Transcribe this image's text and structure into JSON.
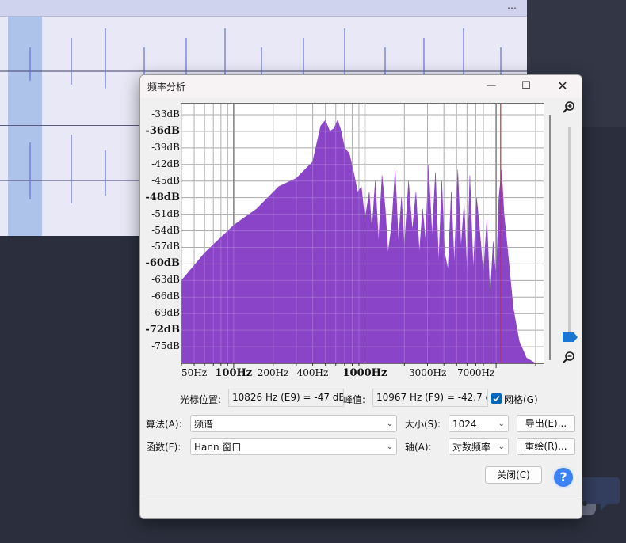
{
  "background": {
    "menu_dots": "⋯"
  },
  "dialog": {
    "title": "频率分析",
    "minimize_glyph": "—",
    "maximize_glyph": "☐",
    "close_glyph": "✕",
    "cursor_label": "光标位置:",
    "cursor_value": "10826 Hz (E9) = -47 dB",
    "peak_label": "峰值:",
    "peak_value": "10967 Hz (F9) = -42.7 d",
    "grid_label": "网格(G)",
    "grid_checked": true,
    "algorithm_label": "算法(A):",
    "algorithm_value": "频谱",
    "size_label": "大小(S):",
    "size_value": "1024",
    "export_button": "导出(E)...",
    "function_label": "函数(F):",
    "function_value": "Hann 窗口",
    "axis_label": "轴(A):",
    "axis_value": "对数频率",
    "replot_button": "重绘(R)...",
    "close_button": "关闭(C)",
    "help_glyph": "?"
  },
  "chart_data": {
    "type": "area",
    "x_scale": "log",
    "y_unit": "dB",
    "fill_color": "#8a44c8",
    "cursor_color": "#d0302f",
    "cursor_hz": 10826,
    "grid": true,
    "xlim": [
      40,
      23000
    ],
    "ylim": [
      -78,
      -31
    ],
    "y_ticks": [
      {
        "label": "-33dB",
        "major": false
      },
      {
        "label": "-36dB",
        "major": true
      },
      {
        "label": "-39dB",
        "major": false
      },
      {
        "label": "-42dB",
        "major": false
      },
      {
        "label": "-45dB",
        "major": false
      },
      {
        "label": "-48dB",
        "major": true
      },
      {
        "label": "-51dB",
        "major": false
      },
      {
        "label": "-54dB",
        "major": false
      },
      {
        "label": "-57dB",
        "major": false
      },
      {
        "label": "-60dB",
        "major": true
      },
      {
        "label": "-63dB",
        "major": false
      },
      {
        "label": "-66dB",
        "major": false
      },
      {
        "label": "-69dB",
        "major": false
      },
      {
        "label": "-72dB",
        "major": true
      },
      {
        "label": "-75dB",
        "major": false
      }
    ],
    "x_ticks": [
      {
        "label": "50Hz",
        "major": false
      },
      {
        "label": "100Hz",
        "major": true
      },
      {
        "label": "200Hz",
        "major": false
      },
      {
        "label": "400Hz",
        "major": false
      },
      {
        "label": "1000Hz",
        "major": true
      },
      {
        "label": "3000Hz",
        "major": false
      },
      {
        "label": "7000Hz",
        "major": false
      }
    ],
    "points": [
      [
        40,
        -63
      ],
      [
        60,
        -58
      ],
      [
        100,
        -53
      ],
      [
        150,
        -50
      ],
      [
        220,
        -46
      ],
      [
        300,
        -44.5
      ],
      [
        400,
        -41.5
      ],
      [
        460,
        -35
      ],
      [
        500,
        -34
      ],
      [
        540,
        -36
      ],
      [
        580,
        -35.5
      ],
      [
        620,
        -34
      ],
      [
        660,
        -36
      ],
      [
        700,
        -39
      ],
      [
        760,
        -40
      ],
      [
        830,
        -44
      ],
      [
        880,
        -47
      ],
      [
        940,
        -46
      ],
      [
        1000,
        -52
      ],
      [
        1080,
        -47
      ],
      [
        1130,
        -54
      ],
      [
        1200,
        -45
      ],
      [
        1270,
        -56
      ],
      [
        1350,
        -44
      ],
      [
        1430,
        -50
      ],
      [
        1500,
        -58
      ],
      [
        1600,
        -53
      ],
      [
        1700,
        -43
      ],
      [
        1800,
        -56
      ],
      [
        1900,
        -48
      ],
      [
        2000,
        -57
      ],
      [
        2150,
        -45
      ],
      [
        2300,
        -54
      ],
      [
        2450,
        -47
      ],
      [
        2600,
        -58
      ],
      [
        2750,
        -50
      ],
      [
        2900,
        -56
      ],
      [
        3050,
        -42
      ],
      [
        3250,
        -55
      ],
      [
        3450,
        -43.5
      ],
      [
        3650,
        -60
      ],
      [
        3850,
        -45
      ],
      [
        4050,
        -58
      ],
      [
        4300,
        -61
      ],
      [
        4550,
        -47
      ],
      [
        4800,
        -60
      ],
      [
        5100,
        -43
      ],
      [
        5400,
        -57
      ],
      [
        5700,
        -49
      ],
      [
        6000,
        -62
      ],
      [
        6300,
        -44
      ],
      [
        6700,
        -61
      ],
      [
        7100,
        -48
      ],
      [
        7500,
        -54
      ],
      [
        8000,
        -62
      ],
      [
        8500,
        -52
      ],
      [
        9000,
        -66
      ],
      [
        9500,
        -56
      ],
      [
        10000,
        -63
      ],
      [
        10500,
        -48
      ],
      [
        11000,
        -43
      ],
      [
        11500,
        -51
      ],
      [
        12300,
        -58
      ],
      [
        13500,
        -68
      ],
      [
        15000,
        -74
      ],
      [
        17000,
        -77
      ],
      [
        20000,
        -78
      ],
      [
        23000,
        -78
      ]
    ]
  }
}
